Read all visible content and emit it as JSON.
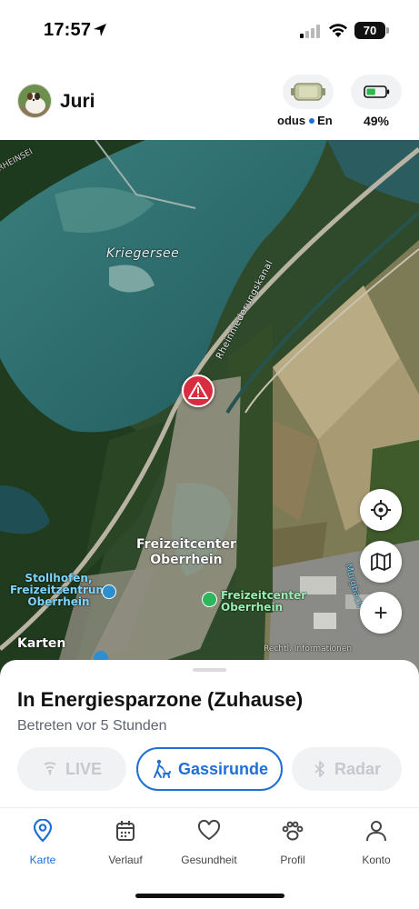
{
  "status_bar": {
    "time": "17:57",
    "battery_level": "70"
  },
  "header": {
    "user_name": "Juri",
    "device_caption_mode": "odus",
    "device_caption_next": "En",
    "battery_percent": "49%",
    "battery_fill": 0.49
  },
  "map": {
    "lake_label": "Kriegersee",
    "canal_label": "Rheinniederungskanal",
    "road_label": "RHEINSEI",
    "area_label_line1": "Freizeitcenter",
    "area_label_line2": "Oberrhein",
    "poi_stoll_line1": "Stollhofen,",
    "poi_stoll_line2": "Freizeitzentrum",
    "poi_stoll_line3": "Oberrhein",
    "poi_fz_line1": "Freizeitcenter",
    "poi_fz_line2": "Oberrhein",
    "attribution_brand": "Karten",
    "attribution_legal": "Rechtl. Informationen",
    "river_label": "Murgbach",
    "zoom_in_symbol": "+"
  },
  "sheet": {
    "zone_title": "In Energiesparzone (Zuhause)",
    "zone_subtitle": "Betreten vor 5 Stunden",
    "mode_live": "LIVE",
    "mode_gassi": "Gassirunde",
    "mode_radar": "Radar"
  },
  "tabs": [
    {
      "label": "Karte",
      "icon": "map-pin-icon",
      "active": true
    },
    {
      "label": "Verlauf",
      "icon": "calendar-icon",
      "active": false
    },
    {
      "label": "Gesundheit",
      "icon": "heart-icon",
      "active": false
    },
    {
      "label": "Profil",
      "icon": "paw-icon",
      "active": false
    },
    {
      "label": "Konto",
      "icon": "person-icon",
      "active": false
    }
  ],
  "colors": {
    "accent": "#1f6fd6",
    "alert": "#d72d3f",
    "battery_green": "#2db84d",
    "lake": "#2d6b6c"
  }
}
